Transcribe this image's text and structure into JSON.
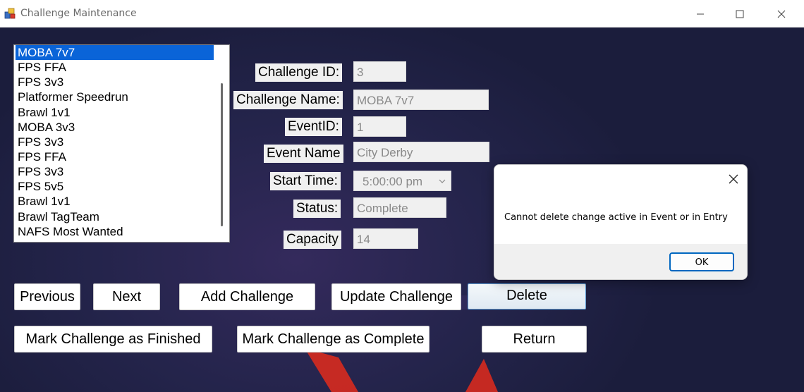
{
  "window": {
    "title": "Challenge Maintenance"
  },
  "icons": {
    "app": "app-icon",
    "minimize": "minimize-icon",
    "maximize": "maximize-icon",
    "close": "close-icon",
    "dropdown": "chevron-down-icon"
  },
  "list": {
    "items": [
      "MOBA 7v7",
      "FPS FFA",
      "FPS 3v3",
      "Platformer Speedrun",
      "Brawl 1v1",
      "MOBA 3v3",
      "FPS 3v3",
      "FPS FFA",
      "FPS 3v3",
      "FPS 5v5",
      "Brawl 1v1",
      "Brawl TagTeam",
      "NAFS Most Wanted"
    ],
    "selected": "MOBA 7v7"
  },
  "form": {
    "challenge_id": {
      "label": "Challenge ID:",
      "value": "3"
    },
    "challenge_name": {
      "label": "Challenge Name:",
      "value": "MOBA 7v7"
    },
    "event_id": {
      "label": "EventID:",
      "value": "1"
    },
    "event_name": {
      "label": "Event Name",
      "value": "City Derby"
    },
    "start_time": {
      "label": "Start Time:",
      "value": "5:00:00 pm"
    },
    "status": {
      "label": "Status:",
      "value": "Complete"
    },
    "capacity": {
      "label": "Capacity",
      "value": "14"
    }
  },
  "buttons": {
    "previous": "Previous",
    "next": "Next",
    "add": "Add Challenge",
    "update": "Update Challenge",
    "delete": "Delete",
    "mark_finished": "Mark Challenge as Finished",
    "mark_complete": "Mark Challenge as Complete",
    "return": "Return"
  },
  "dialog": {
    "message": "Cannot delete change active in Event or in Entry",
    "ok": "OK",
    "close": "✕"
  },
  "colors": {
    "background": "#1f2140",
    "selection": "#0a64d8",
    "beam": "#d42a1f",
    "dialog_accent": "#0067c0"
  }
}
